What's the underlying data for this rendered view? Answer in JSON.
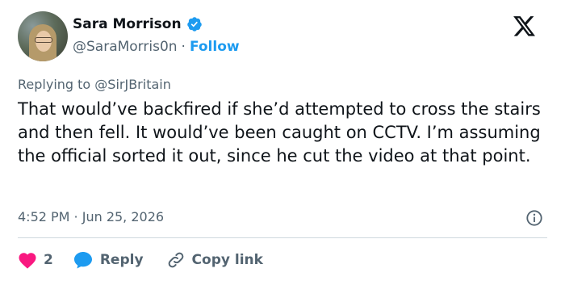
{
  "author": {
    "display_name": "Sara Morrison",
    "handle": "@SaraMorris0n",
    "separator": "·",
    "follow_label": "Follow"
  },
  "reply_context": {
    "prefix": "Replying to",
    "mention": "@SirJBritain"
  },
  "tweet": {
    "text": "That would’ve backfired if she’d attempted to cross the stairs and then fell. It would’ve been caught on CCTV. I’m assuming the official sorted it out, since he cut the video at that point.",
    "timestamp": "4:52 PM · Jun 25, 2026"
  },
  "actions": {
    "like_count": "2",
    "reply_label": "Reply",
    "copy_link_label": "Copy link"
  },
  "colors": {
    "accent": "#1d9bf0",
    "like": "#f91880",
    "muted": "#536471",
    "text": "#0f1419"
  },
  "icons": [
    "verified-badge-icon",
    "x-logo-icon",
    "info-icon",
    "heart-icon",
    "speech-bubble-icon",
    "link-icon"
  ]
}
